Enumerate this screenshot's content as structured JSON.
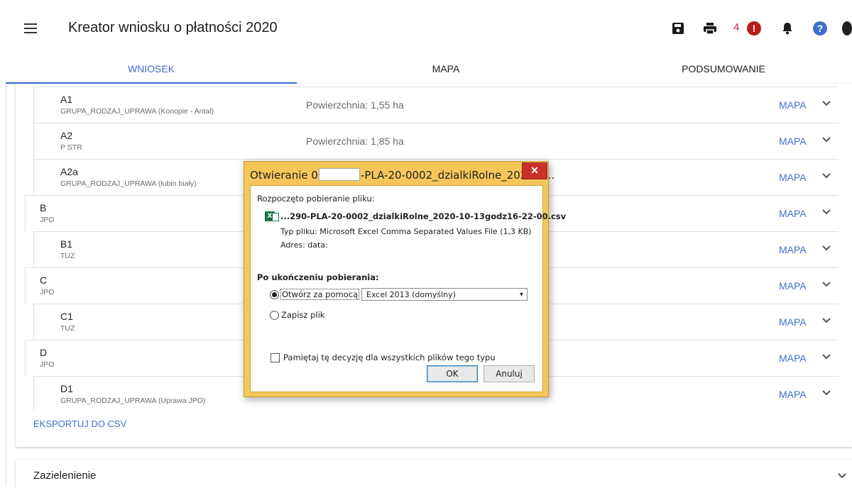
{
  "app": {
    "title": "Kreator wniosku o płatności 2020",
    "notification_count": "4",
    "alert_mark": "!",
    "help_mark": "?"
  },
  "tabs": [
    {
      "label": "WNIOSEK",
      "active": true
    },
    {
      "label": "MAPA",
      "active": false
    },
    {
      "label": "PODSUMOWANIE",
      "active": false
    }
  ],
  "parcels": [
    {
      "code": "A1",
      "sub": "GRUPA_RODZAJ_UPRAWA (Konopie - Antal)",
      "area": "Powierzchnia: 1,55 ha",
      "map_label": "MAPA"
    },
    {
      "code": "A2",
      "sub": "P STR",
      "area": "Powierzchnia: 1,85 ha",
      "map_label": "MAPA"
    },
    {
      "code": "A2a",
      "sub": "GRUPA_RODZAJ_UPRAWA (łubin biały)",
      "area": "",
      "map_label": "MAPA"
    },
    {
      "code": "B",
      "sub": "JPO",
      "area": "",
      "map_label": "MAPA"
    },
    {
      "code": "B1",
      "sub": "TUZ",
      "area": "",
      "map_label": "MAPA"
    },
    {
      "code": "C",
      "sub": "JPO",
      "area": "",
      "map_label": "MAPA"
    },
    {
      "code": "C1",
      "sub": "TUZ",
      "area": "",
      "map_label": "MAPA"
    },
    {
      "code": "D",
      "sub": "JPO",
      "area": "",
      "map_label": "MAPA"
    },
    {
      "code": "D1",
      "sub": "GRUPA_RODZAJ_UPRAWA (Uprawa JPO)",
      "area": "",
      "map_label": "MAPA"
    }
  ],
  "export_label": "EKSPORTUJ DO CSV",
  "bottom_section": "Zazielenienie",
  "dialog": {
    "title_prefix": "Otwieranie 0",
    "title_suffix": "-PLA-20-0002_dzialkiRolne_2020-1...",
    "close_label": "✕",
    "started": "Rozpoczęto pobieranie pliku:",
    "file_icon_letter": "X",
    "filename": "...290-PLA-20-0002_dzialkiRolne_2020-10-13godz16-22-00.csv",
    "file_type": "Typ pliku: Microsoft Excel Comma Separated Values File (1,3 KB)",
    "address": "Adres: data:",
    "after_download": "Po ukończeniu pobierania:",
    "open_with_label": "Otwórz za pomocą",
    "open_with_selected": true,
    "app_selected": "Excel 2013 (domyślny)",
    "save_label": "Zapisz plik",
    "save_selected": false,
    "remember_label": "Pamiętaj tę decyzję dla wszystkich plików tego typu",
    "remember_checked": false,
    "ok_label": "OK",
    "cancel_label": "Anuluj"
  }
}
